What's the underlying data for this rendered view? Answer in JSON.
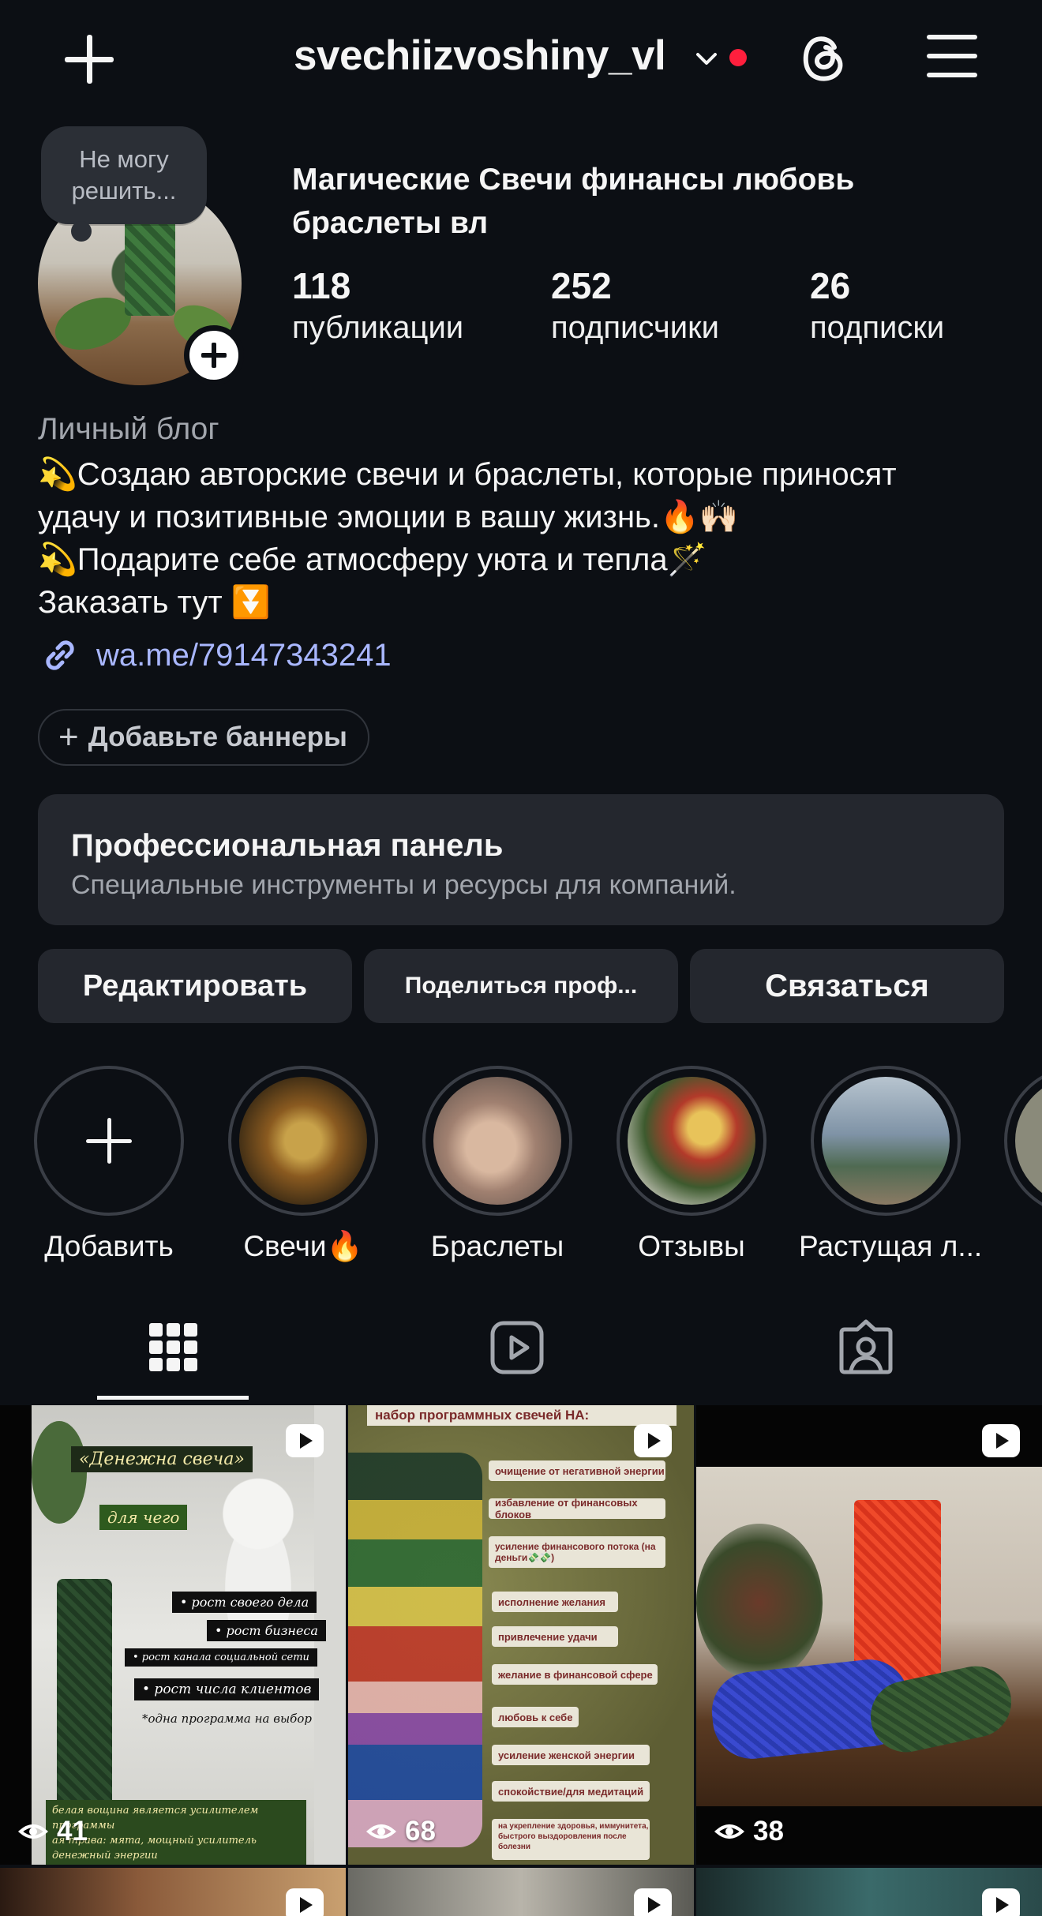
{
  "header": {
    "username": "svechiizvoshiny_vl",
    "icons": {
      "add": "plus-icon",
      "dropdown": "chevron-down-icon",
      "threads": "threads-icon",
      "menu": "hamburger-icon"
    },
    "notification_dot_color": "#ff1f3d"
  },
  "profile": {
    "note": "Не могу решить...",
    "display_name": "Магические Свечи финансы любовь браслеты вл",
    "stats": [
      {
        "value": "118",
        "label": "публикации"
      },
      {
        "value": "252",
        "label": "подписчики"
      },
      {
        "value": "26",
        "label": "подписки"
      }
    ],
    "category": "Личный блог",
    "bio_lines": [
      "💫Создаю авторские свечи и браслеты, которые приносят",
      "удачу и позитивные эмоции в вашу жизнь.🔥🙌🏻",
      "💫Подарите себе атмосферу уюта и тепла🪄",
      "Заказать тут ⏬"
    ],
    "link": "wa.me/79147343241",
    "link_color": "#a9b7ff",
    "add_banners": "Добавьте баннеры"
  },
  "pro_panel": {
    "title": "Профессиональная панель",
    "subtitle": "Специальные инструменты и ресурсы для компаний."
  },
  "actions": {
    "edit": "Редактировать",
    "share": "Поделиться проф...",
    "contact": "Связаться"
  },
  "highlights": [
    {
      "label": "Добавить"
    },
    {
      "label": "Свечи🔥"
    },
    {
      "label": "Браслеты"
    },
    {
      "label": "Отзывы"
    },
    {
      "label": "Растущая л..."
    }
  ],
  "tabs": {
    "grid": "grid-icon",
    "reels": "reels-icon",
    "tagged": "tagged-icon",
    "active": "grid"
  },
  "posts": [
    {
      "views": "41",
      "title": "«Денежна свеча»",
      "sub": "для чего",
      "items": [
        "• рост своего дела",
        "• рост бизнеса",
        "• рост канала  социальной сети",
        "• рост числа клиентов",
        "*одна программа на выбор"
      ],
      "footer": [
        "белая вощина является усилителем программы",
        "ая трава: мята, мощный усилитель",
        "денежный энергии"
      ]
    },
    {
      "views": "68",
      "header": "набор программных свечей НА:",
      "items": [
        "очищение от негативной энергии",
        "избавление от финансовых блоков",
        "усиление финансового потока (на деньги💸💸)",
        "исполнение желания",
        "привлечение удачи",
        "желание в финансовой сфере",
        "любовь к себе",
        "усиление женской энергии",
        "спокойствие/для медитаций",
        "на укрепление здоровья, иммунитета, быстрого выздоровления после болезни"
      ]
    },
    {
      "views": "38"
    }
  ]
}
